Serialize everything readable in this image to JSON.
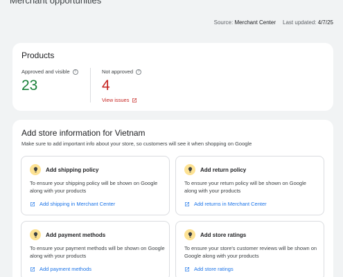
{
  "header": {
    "title": "Merchant opportunities",
    "source_label": "Source:",
    "source_value": "Merchant Center",
    "updated_label": "Last updated:",
    "updated_value": "4/7/25"
  },
  "products": {
    "title": "Products",
    "approved_label": "Approved and visible",
    "approved_value": "23",
    "not_approved_label": "Not approved",
    "not_approved_value": "4",
    "view_issues_label": "View issues"
  },
  "store_info": {
    "title": "Add store information for Vietnam",
    "subtitle": "Make sure to add important info about your store, so customers will see it when shopping on Google",
    "tiles": [
      {
        "title": "Add shipping policy",
        "description": "To ensure your shipping policy will be shown on Google along with your products",
        "link": "Add shipping in Merchant Center"
      },
      {
        "title": "Add return policy",
        "description": "To ensure your return policy will be shown on Google along with your products",
        "link": "Add returns in Merchant Center"
      },
      {
        "title": "Add payment methods",
        "description": "To ensure your payment methods will be shown on Google along with your products",
        "link": "Add payment methods"
      },
      {
        "title": "Add store ratings",
        "description": "To ensure your store's customer reviews will be shown on Google along with your products",
        "link": "Add store ratings"
      }
    ]
  },
  "colors": {
    "approved": "#188038",
    "not_approved": "#c5221f",
    "link": "#1a73e8",
    "bulb": "#fde293"
  },
  "icons": {
    "info": "info-icon",
    "external": "open-in-new-icon",
    "lightbulb": "lightbulb-icon",
    "edit": "edit-external-icon"
  }
}
